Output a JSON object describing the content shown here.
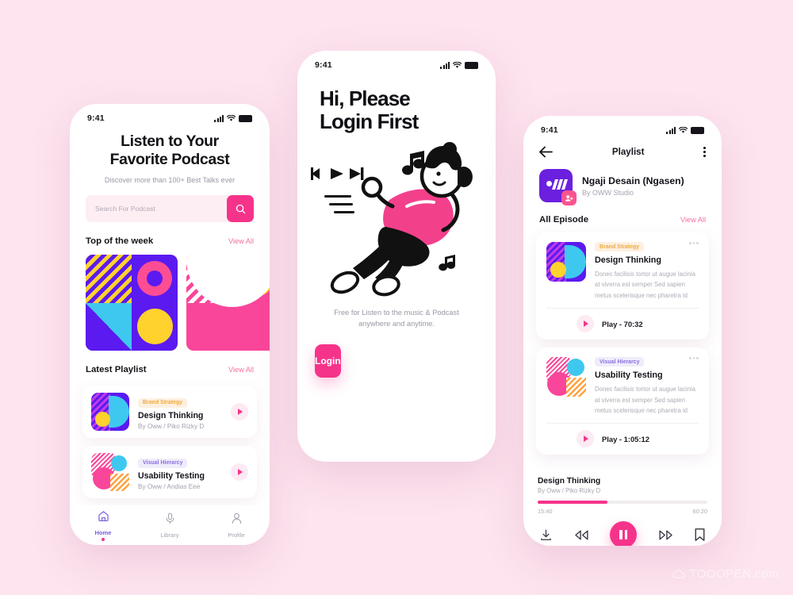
{
  "background": "#fde4ef",
  "accent_pink": "#f6338a",
  "accent_purple": "#6b1fdf",
  "status_bar": {
    "time": "9:41",
    "signal_icon": "cellular-bars-icon",
    "wifi_icon": "wifi-icon",
    "battery_icon": "battery-icon"
  },
  "home_screen": {
    "title_line1": "Listen to Your",
    "title_line2": "Favorite Podcast",
    "subtitle": "Discover more than 100+ Best Talks ever",
    "search": {
      "placeholder": "Search For Podcast",
      "value": "",
      "icon": "search-icon"
    },
    "sections": [
      {
        "title": "Top of the week",
        "view_all": "View All"
      },
      {
        "title": "Latest Playlist",
        "view_all": "View All"
      }
    ],
    "artwork": [
      {
        "name": "abstract-art-purple",
        "colors": [
          "#5b1aef",
          "#ffd22e",
          "#ff4d94",
          "#3ec8f0"
        ]
      },
      {
        "name": "abstract-art-pink",
        "colors": [
          "#f9469a",
          "#ffd22e",
          "#ffffff"
        ]
      }
    ],
    "playlist": [
      {
        "badge": "Brand Strategy",
        "badge_style": "orange",
        "title": "Design Thinking",
        "artist": "By Oww / Piko Rizky D",
        "play_icon": "play-icon"
      },
      {
        "badge": "Visual Hierarcy",
        "badge_style": "violet",
        "title": "Usability Testing",
        "artist": "By Oww / Andias Eee",
        "play_icon": "play-icon"
      }
    ],
    "tabs": [
      {
        "label": "Home",
        "icon": "home-icon",
        "active": true
      },
      {
        "label": "Library",
        "icon": "microphone-icon",
        "active": false
      },
      {
        "label": "Profile",
        "icon": "person-icon",
        "active": false
      }
    ]
  },
  "login_screen": {
    "title_line1": "Hi, Please",
    "title_line2": "Login First",
    "illustration": "person-listening-music-illustration",
    "caption_line1": "Free for Listen to the music & Podcast",
    "caption_line2": "anywhere and anytime.",
    "login_button": "Login"
  },
  "playlist_screen": {
    "nav": {
      "back_icon": "back-arrow-icon",
      "title": "Playlist",
      "menu_icon": "kebab-menu-icon"
    },
    "podcast": {
      "logo_icon": "podcast-logo-icon",
      "badge_icon": "add-person-icon",
      "name": "Ngaji Desain (Ngasen)",
      "author": "By OWW Studio"
    },
    "section": {
      "title": "All Episode",
      "view_all": "View All"
    },
    "episodes": [
      {
        "badge": "Brand Strategy",
        "badge_style": "orange",
        "title": "Design Thinking",
        "description": "Donec facilisis tortor ut augue lacinia at viverra est semper Sed sapien metus scelerisque nec pharetra id",
        "play_label": "Play - 70:32",
        "play_icon": "play-icon",
        "more_icon": "more-dots-icon",
        "thumb_colors": [
          "#5b1aef",
          "#ffd22e",
          "#ff4d94",
          "#3ec8f0"
        ]
      },
      {
        "badge": "Visual Hierarcy",
        "badge_style": "violet",
        "title": "Usability Testing",
        "description": "Donec facilisis tortor ut augue lacinia at viverra est semper Sed sapien metus scelerisque nec pharetra id",
        "play_label": "Play - 1:05:12",
        "play_icon": "play-icon",
        "more_icon": "more-dots-icon",
        "thumb_colors": [
          "#f9469a",
          "#3ec8f0",
          "#ffa23e"
        ]
      }
    ],
    "player": {
      "track": "Design Thinking",
      "artist": "By Oww / Piko Rizky D",
      "elapsed": "15:40",
      "total": "60:20",
      "progress_percent": 41,
      "controls": [
        {
          "name": "download-icon"
        },
        {
          "name": "rewind-icon"
        },
        {
          "name": "pause-icon"
        },
        {
          "name": "fast-forward-icon"
        },
        {
          "name": "bookmark-icon"
        }
      ]
    }
  },
  "watermark": {
    "text": "TOOOPEN.com",
    "icon": "cloud-icon"
  }
}
